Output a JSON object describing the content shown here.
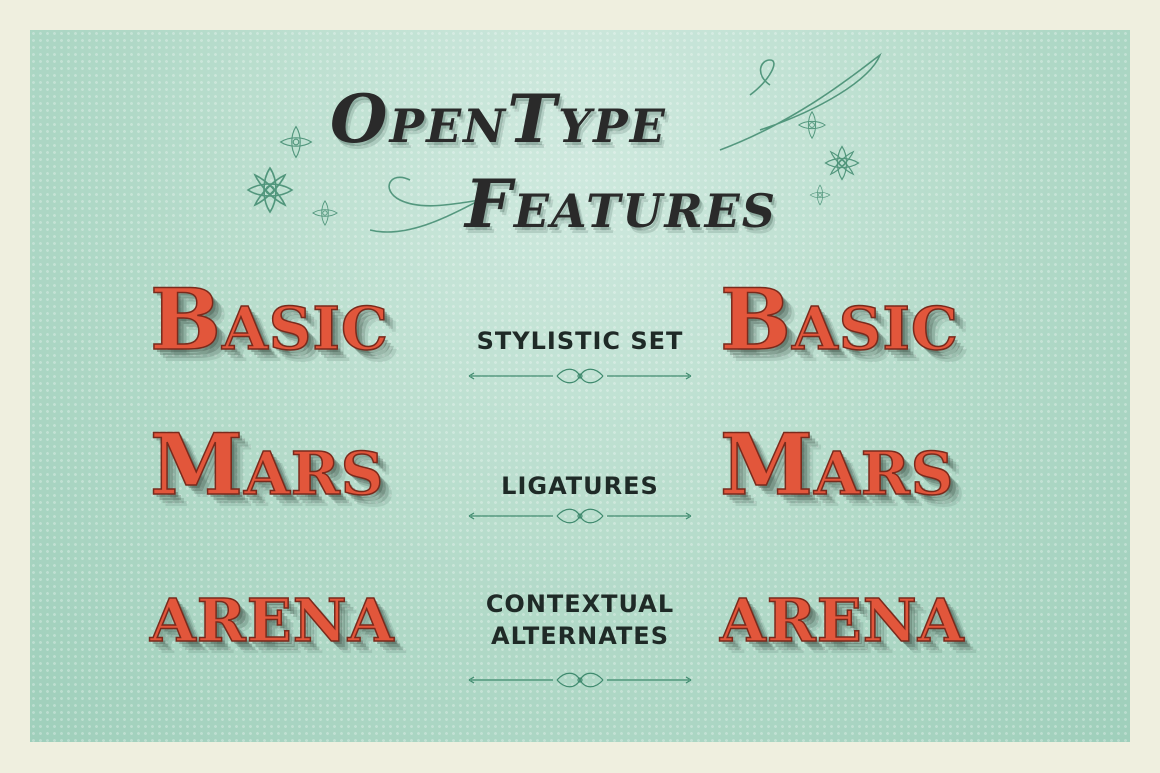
{
  "title": {
    "line1": "OpenType",
    "line2": "Features"
  },
  "rows": [
    {
      "left_word": "Basic",
      "feature": "STYLISTIC SET",
      "right_word": "Basic"
    },
    {
      "left_word": "Mars",
      "feature": "LIGATURES",
      "right_word": "Mars"
    },
    {
      "left_word": "arena",
      "feature_line1": "CONTEXTUAL",
      "feature_line2": "ALTERNATES",
      "right_word": "arena"
    }
  ],
  "colors": {
    "background": "#b6dccb",
    "frame": "#efefdf",
    "sample_word": "#e2563b",
    "title_text": "#2a2a2a",
    "ornament": "#3f8a6e"
  },
  "icons": [
    "flower-ornament-icon",
    "swash-ornament-icon",
    "divider-flourish-icon"
  ]
}
